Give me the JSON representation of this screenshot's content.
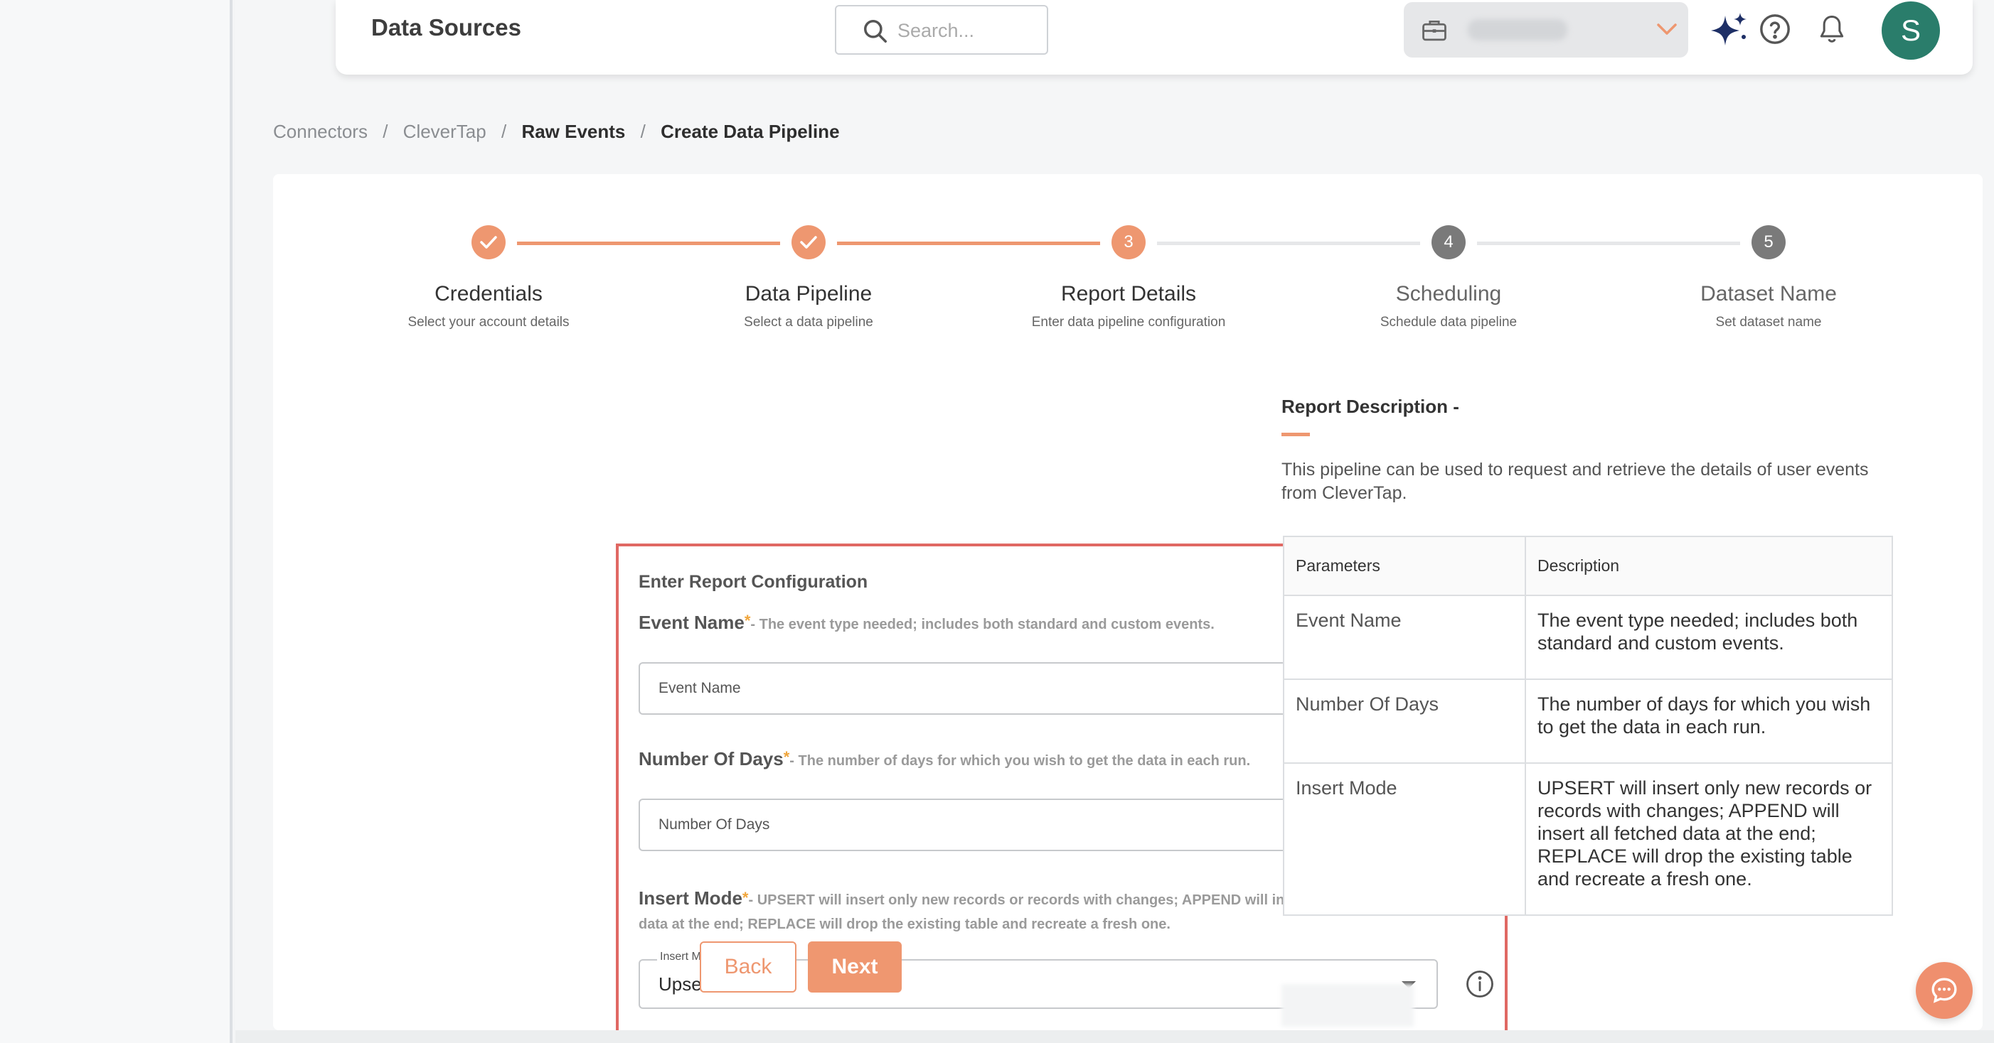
{
  "header": {
    "title": "Data Sources",
    "search_placeholder": "Search...",
    "avatar_initial": "S"
  },
  "breadcrumb": [
    "Connectors",
    "CleverTap",
    "Raw Events",
    "Create Data Pipeline"
  ],
  "stepper": {
    "steps": [
      {
        "number": "1",
        "title": "Credentials",
        "subtitle": "Select your account details",
        "state": "completed"
      },
      {
        "number": "2",
        "title": "Data Pipeline",
        "subtitle": "Select a data pipeline",
        "state": "completed"
      },
      {
        "number": "3",
        "title": "Report Details",
        "subtitle": "Enter data pipeline configuration",
        "state": "active"
      },
      {
        "number": "4",
        "title": "Scheduling",
        "subtitle": "Schedule data pipeline",
        "state": "pending"
      },
      {
        "number": "5",
        "title": "Dataset Name",
        "subtitle": "Set dataset name",
        "state": "pending"
      }
    ]
  },
  "form": {
    "heading": "Enter Report Configuration",
    "event_name": {
      "label": "Event Name",
      "required_mark": "*",
      "hint": "- The event type needed; includes both standard and custom events.",
      "placeholder": "Event Name",
      "value": ""
    },
    "number_of_days": {
      "label": "Number Of Days",
      "required_mark": "*",
      "hint": "- The number of days for which you wish to get the data in each run.",
      "placeholder": "Number Of Days",
      "value": ""
    },
    "insert_mode": {
      "label": "Insert Mode",
      "required_mark": "*",
      "hint": "- UPSERT will insert only new records or records with changes; APPEND will insert all fetched data at the end; REPLACE will drop the existing table and recreate a fresh one.",
      "float_label": "Insert Mode",
      "selected": "Upsert"
    }
  },
  "buttons": {
    "back": "Back",
    "next": "Next"
  },
  "description": {
    "title": "Report Description -",
    "text": "This pipeline can be used to request and retrieve the details of user events from CleverTap.",
    "table_headers": [
      "Parameters",
      "Description"
    ],
    "rows": [
      [
        "Event Name",
        "The event type needed; includes both standard and custom events."
      ],
      [
        "Number Of Days",
        "The number of days for which you wish to get the data in each run."
      ],
      [
        "Insert Mode",
        "UPSERT will insert only new records or records with changes; APPEND will insert all fetched data at the end; REPLACE will drop the existing table and recreate a fresh one."
      ]
    ]
  },
  "colors": {
    "accent": "#ee9770",
    "step_pending": "#7a7a7a",
    "highlight_border": "#e06863",
    "avatar": "#2a7d6b"
  },
  "icons": {
    "search": "search-icon",
    "workspace": "briefcase-icon",
    "dropdown": "chevron-down-icon",
    "ai": "sparkles-icon",
    "help": "help-circle-icon",
    "notifications": "bell-icon",
    "info": "info-icon",
    "chat": "chat-bubble-icon"
  }
}
